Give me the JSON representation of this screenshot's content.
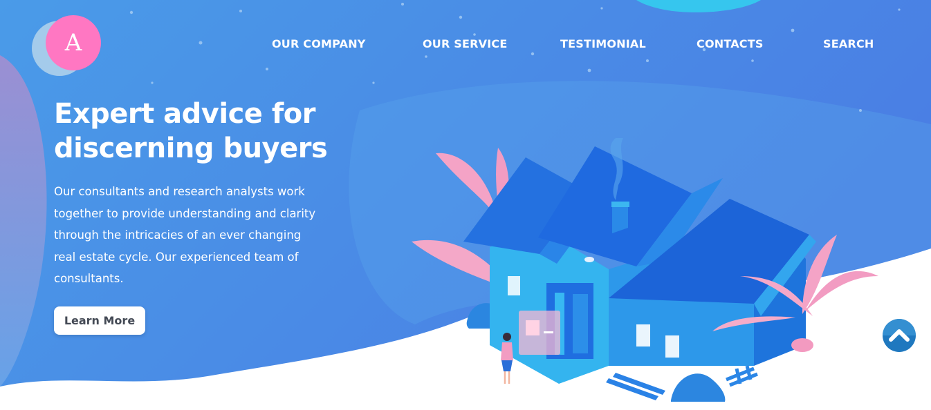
{
  "brand": {
    "logo_letter": "A"
  },
  "nav": {
    "items": [
      {
        "label": "OUR COMPANY"
      },
      {
        "label": "OUR SERVICE"
      },
      {
        "label": "TESTIMONIAL"
      },
      {
        "label": "CONTACTS"
      },
      {
        "label": "SEARCH"
      }
    ]
  },
  "hero": {
    "title_line1": "Expert advice for",
    "title_line2": "discerning buyers",
    "body_line1": "Our consultants and research analysts work",
    "body_line2": "together to provide understanding and clarity",
    "body_line3": "through the intricacies of an ever changing",
    "body_line4": "real estate cycle. Our experienced team of",
    "body_line5": "consultants.",
    "cta_label": "Learn More"
  },
  "colors": {
    "hero_background": "#4a8fe6",
    "logo_pink": "#ff77c2",
    "logo_back": "#a9cdeb",
    "cta_text": "#444a55",
    "house_blue": "#2f7ae6",
    "plant_pink": "#f39ac0",
    "scroll_button": "#1f78bf"
  },
  "icons": {
    "scroll_top": "chevron-up-icon",
    "illustration": "isometric-house-illustration"
  }
}
